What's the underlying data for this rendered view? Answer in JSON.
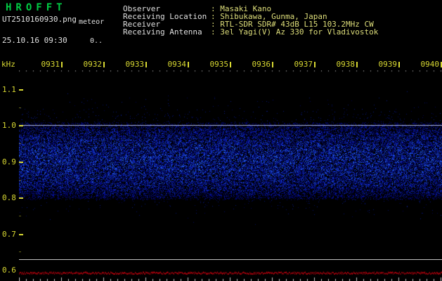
{
  "app": {
    "title": "HROFFT",
    "filename": "UT2510160930.png",
    "filename_note": "meteor",
    "datetime": "25.10.16 09:30",
    "counter": "0.."
  },
  "station": {
    "rows": [
      {
        "label": "Observer",
        "value": ": Masaki Kano"
      },
      {
        "label": "Receiving Location",
        "value": ": Shibukawa, Gunma, Japan"
      },
      {
        "label": "Receiver",
        "value": ": RTL-SDR SDR# 43dB L15 103.2MHz CW"
      },
      {
        "label": "Receiving Antenna",
        "value": ": 3el Yagi(V) Az 330 for Vladivostok"
      }
    ]
  },
  "axes": {
    "y_unit": "kHz",
    "y_ticks": [
      "1.1",
      "1.0",
      "0.9",
      "0.8",
      "0.7",
      "0.6"
    ],
    "x_ticks": [
      "0931",
      "0932",
      "0933",
      "0934",
      "0935",
      "0936",
      "0937",
      "0938",
      "0939",
      "0940"
    ]
  },
  "colors": {
    "background": "#000000",
    "title_green": "#00cc44",
    "text_white": "#e0e0e0",
    "value_yellow": "#dede7a",
    "axis_yellow": "#d8d832",
    "noise_blue": "#2040c8",
    "noise_bright_blue": "#90b0ff",
    "carrier_white": "#ccd8ff",
    "trace_red": "#8b0000",
    "separator_gray": "#c0c0c0"
  },
  "chart_data": {
    "type": "heatmap",
    "subtype": "radio-meteor-spectrogram",
    "title": "HROFFT 10-minute meteor radio spectrogram, 2025-10-16 09:30-09:40 UT",
    "x": {
      "ticks": [
        "0931",
        "0932",
        "0933",
        "0934",
        "0935",
        "0936",
        "0937",
        "0938",
        "0939",
        "0940"
      ],
      "start_ut": "09:30",
      "end_ut": "09:40",
      "tick_interval_seconds": 60
    },
    "y": {
      "unit": "kHz",
      "ticks": [
        1.1,
        1.0,
        0.9,
        0.8,
        0.7,
        0.6
      ],
      "top": 1.15,
      "bottom": 0.63
    },
    "noise_band": {
      "low_khz": 0.8,
      "high_khz": 1.0,
      "peak_khz": 0.91,
      "appearance": "dense blue speckle noise, uniform across the full 10 minutes"
    },
    "carrier_line_khz": 1.0,
    "meteor_echoes": [],
    "bottom_strip": {
      "content": "signal-level trace",
      "appearance": "flat dark-red baseline with white minute/second tick marks"
    }
  }
}
